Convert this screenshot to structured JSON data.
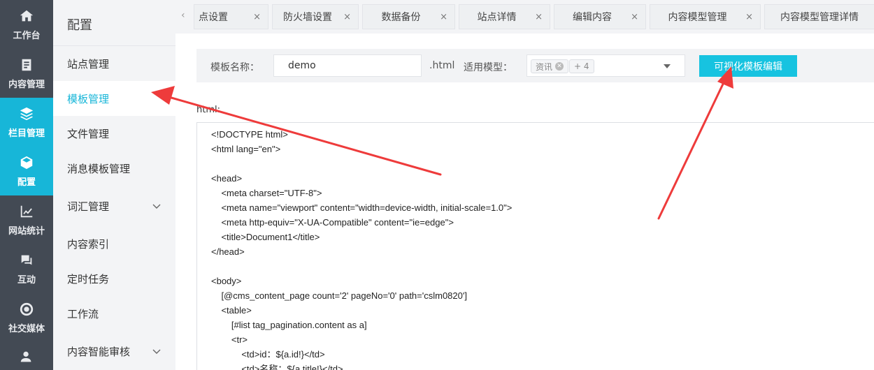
{
  "rail": {
    "items": [
      {
        "label": "工作台",
        "icon": "home-icon"
      },
      {
        "label": "内容管理",
        "icon": "content-icon"
      },
      {
        "label": "栏目管理",
        "icon": "layers-icon"
      },
      {
        "label": "配置",
        "icon": "cube-icon"
      },
      {
        "label": "网站统计",
        "icon": "chart-icon"
      },
      {
        "label": "互动",
        "icon": "chat-icon"
      },
      {
        "label": "社交媒体",
        "icon": "social-icon"
      }
    ]
  },
  "sidebar": {
    "title": "配置",
    "items": [
      {
        "label": "站点管理"
      },
      {
        "label": "模板管理"
      },
      {
        "label": "文件管理"
      },
      {
        "label": "消息模板管理"
      },
      {
        "label": "词汇管理"
      },
      {
        "label": "内容索引"
      },
      {
        "label": "定时任务"
      },
      {
        "label": "工作流"
      },
      {
        "label": "内容智能审核"
      }
    ]
  },
  "tabs": {
    "items": [
      {
        "label": "点设置"
      },
      {
        "label": "防火墙设置"
      },
      {
        "label": "数据备份"
      },
      {
        "label": "站点详情"
      },
      {
        "label": "编辑内容"
      },
      {
        "label": "内容模型管理"
      },
      {
        "label": "内容模型管理详情"
      }
    ],
    "close_glyph": "×",
    "scroll_left_glyph": "‹"
  },
  "form": {
    "template_name_label": "模板名称：",
    "template_name_value": "demo",
    "suffix": ".html",
    "model_label": "适用模型：",
    "model_tag": "资讯",
    "model_more": "+ 4",
    "visual_edit_button": "可视化模板编辑"
  },
  "editor": {
    "label": "html:",
    "lines": [
      "<!DOCTYPE html>",
      "<html lang=\"en\">",
      "",
      "<head>",
      "    <meta charset=\"UTF-8\">",
      "    <meta name=\"viewport\" content=\"width=device-width, initial-scale=1.0\">",
      "    <meta http-equiv=\"X-UA-Compatible\" content=\"ie=edge\">",
      "    <title>Document1</title>",
      "</head>",
      "",
      "<body>",
      "    [@cms_content_page count='2' pageNo='0' path='cslm0820']",
      "    <table>",
      "        [#list tag_pagination.content as a]",
      "        <tr>",
      "            <td>id：${a.id!}</td>",
      "            <td>名称：${a.title!}</td>"
    ]
  },
  "colors": {
    "accent": "#17b6d8",
    "button": "#17c3e0",
    "rail_bg": "#434a54",
    "annotation_arrow": "#ee3b3b"
  }
}
